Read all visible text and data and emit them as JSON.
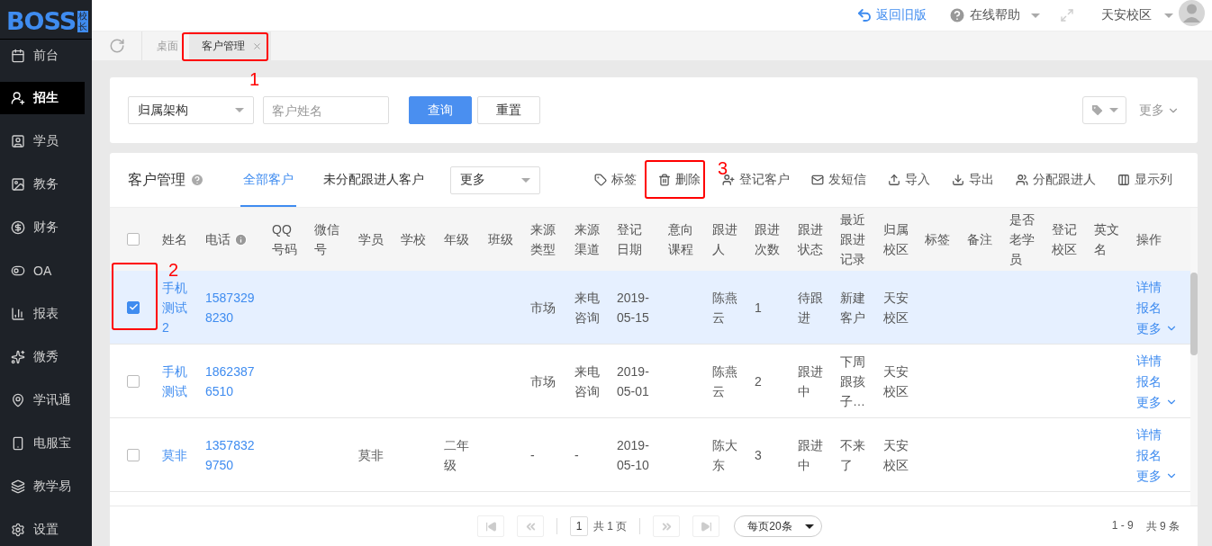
{
  "sidebar": {
    "logo": {
      "text": "BOSS",
      "sub": "校长"
    },
    "items": [
      {
        "label": "前台",
        "selected": false
      },
      {
        "label": "招生",
        "selected": true
      },
      {
        "label": "学员",
        "selected": false
      },
      {
        "label": "教务",
        "selected": false
      },
      {
        "label": "财务",
        "selected": false
      },
      {
        "label": "OA",
        "selected": false
      },
      {
        "label": "报表",
        "selected": false
      },
      {
        "label": "微秀",
        "selected": false
      },
      {
        "label": "学讯通",
        "selected": false
      },
      {
        "label": "电服宝",
        "selected": false
      },
      {
        "label": "教学易",
        "selected": false
      },
      {
        "label": "设置",
        "selected": false
      }
    ]
  },
  "topbar": {
    "back": "返回旧版",
    "help": "在线帮助",
    "campus": "天安校区"
  },
  "tabs": [
    {
      "label": "桌面",
      "selected": false,
      "closable": false
    },
    {
      "label": "客户管理",
      "selected": true,
      "closable": true
    }
  ],
  "filter": {
    "org_select": "归属架构",
    "name_input": {
      "placeholder": "客户姓名"
    },
    "buttons": [
      {
        "label": "查询",
        "kind": "primary"
      },
      {
        "label": "重置",
        "kind": "default"
      }
    ],
    "more": "更多"
  },
  "card": {
    "title": "客户管理",
    "tabs": [
      {
        "label": "全部客户",
        "selected": true
      },
      {
        "label": "未分配跟进人客户",
        "selected": false
      }
    ],
    "more_select": "更多",
    "actions": [
      "标签",
      "删除",
      "登记客户",
      "发短信",
      "导入",
      "导出",
      "分配跟进人",
      "显示列"
    ]
  },
  "table": {
    "select_all": {
      "checked": false
    },
    "columns": [
      {
        "label": "姓名",
        "kind": "link",
        "info": false
      },
      {
        "label": "电话",
        "kind": "link",
        "info": true
      },
      {
        "label": "QQ号码",
        "kind": "text",
        "info": false
      },
      {
        "label": "微信号",
        "kind": "text",
        "info": false
      },
      {
        "label": "学员",
        "kind": "text",
        "info": false
      },
      {
        "label": "学校",
        "kind": "text",
        "info": false
      },
      {
        "label": "年级",
        "kind": "text",
        "info": false
      },
      {
        "label": "班级",
        "kind": "text",
        "info": false
      },
      {
        "label": "来源类型",
        "kind": "text",
        "info": false
      },
      {
        "label": "来源渠道",
        "kind": "text",
        "info": false
      },
      {
        "label": "登记日期",
        "kind": "text",
        "info": false
      },
      {
        "label": "意向课程",
        "kind": "text",
        "info": false
      },
      {
        "label": "跟进人",
        "kind": "text",
        "info": false
      },
      {
        "label": "跟进次数",
        "kind": "text",
        "info": false
      },
      {
        "label": "跟进状态",
        "kind": "text",
        "info": false
      },
      {
        "label": "最近跟进记录",
        "kind": "text",
        "info": false
      },
      {
        "label": "归属校区",
        "kind": "text",
        "info": false
      },
      {
        "label": "标签",
        "kind": "text",
        "info": false
      },
      {
        "label": "备注",
        "kind": "text",
        "info": false
      },
      {
        "label": "是否老学员",
        "kind": "text",
        "info": false
      },
      {
        "label": "登记校区",
        "kind": "text",
        "info": false
      },
      {
        "label": "英文名",
        "kind": "text",
        "info": false
      },
      {
        "label": "操作",
        "kind": "actions",
        "info": false
      }
    ],
    "rows": [
      {
        "selected": true,
        "cells": [
          "手机测试2",
          "15873298230",
          null,
          null,
          null,
          null,
          null,
          null,
          "市场",
          "来电咨询",
          "2019-05-15",
          null,
          "陈燕云",
          "1",
          "待跟进",
          "新建客户",
          "天安校区",
          null,
          null,
          null,
          null,
          null
        ],
        "actions": [
          {
            "label": "详情",
            "kind": "link"
          },
          {
            "label": "报名",
            "kind": "link"
          },
          {
            "label": "更多",
            "kind": "menu"
          }
        ]
      },
      {
        "selected": false,
        "cells": [
          "手机测试",
          "18623876510",
          null,
          null,
          null,
          null,
          null,
          null,
          "市场",
          "来电咨询",
          "2019-05-01",
          null,
          "陈燕云",
          "2",
          "跟进中",
          "下周跟孩子…",
          "天安校区",
          null,
          null,
          null,
          null,
          null
        ],
        "actions": [
          {
            "label": "详情",
            "kind": "link"
          },
          {
            "label": "报名",
            "kind": "link"
          },
          {
            "label": "更多",
            "kind": "menu"
          }
        ]
      },
      {
        "selected": false,
        "cells": [
          "莫非",
          "13578329750",
          null,
          null,
          "莫非",
          null,
          "二年级",
          null,
          "-",
          "-",
          "2019-05-10",
          null,
          "陈大东",
          "3",
          "跟进中",
          "不来了",
          "天安校区",
          null,
          null,
          null,
          null,
          null
        ],
        "actions": [
          {
            "label": "详情",
            "kind": "link"
          },
          {
            "label": "报名",
            "kind": "link"
          },
          {
            "label": "更多",
            "kind": "menu"
          }
        ]
      }
    ]
  },
  "pagination": {
    "page": "1",
    "total_pages": "共 1 页",
    "page_size": "每页20条",
    "range": "1 - 9",
    "total": "共 9 条"
  },
  "annotations": [
    {
      "label": "1"
    },
    {
      "label": "2"
    },
    {
      "label": "3"
    }
  ]
}
